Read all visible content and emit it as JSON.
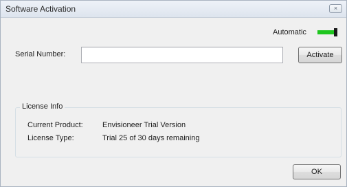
{
  "window": {
    "title": "Software Activation",
    "close_glyph": "×"
  },
  "automatic": {
    "label": "Automatic",
    "toggle_color": "#1fc61f",
    "state": "on"
  },
  "serial": {
    "label": "Serial Number:",
    "value": "",
    "placeholder": ""
  },
  "buttons": {
    "activate": "Activate",
    "ok": "OK"
  },
  "license_info": {
    "title": "License Info",
    "rows": [
      {
        "key": "Current Product:",
        "value": "Envisioneer Trial Version"
      },
      {
        "key": "License Type:",
        "value": "Trial 25 of 30 days remaining"
      }
    ]
  }
}
